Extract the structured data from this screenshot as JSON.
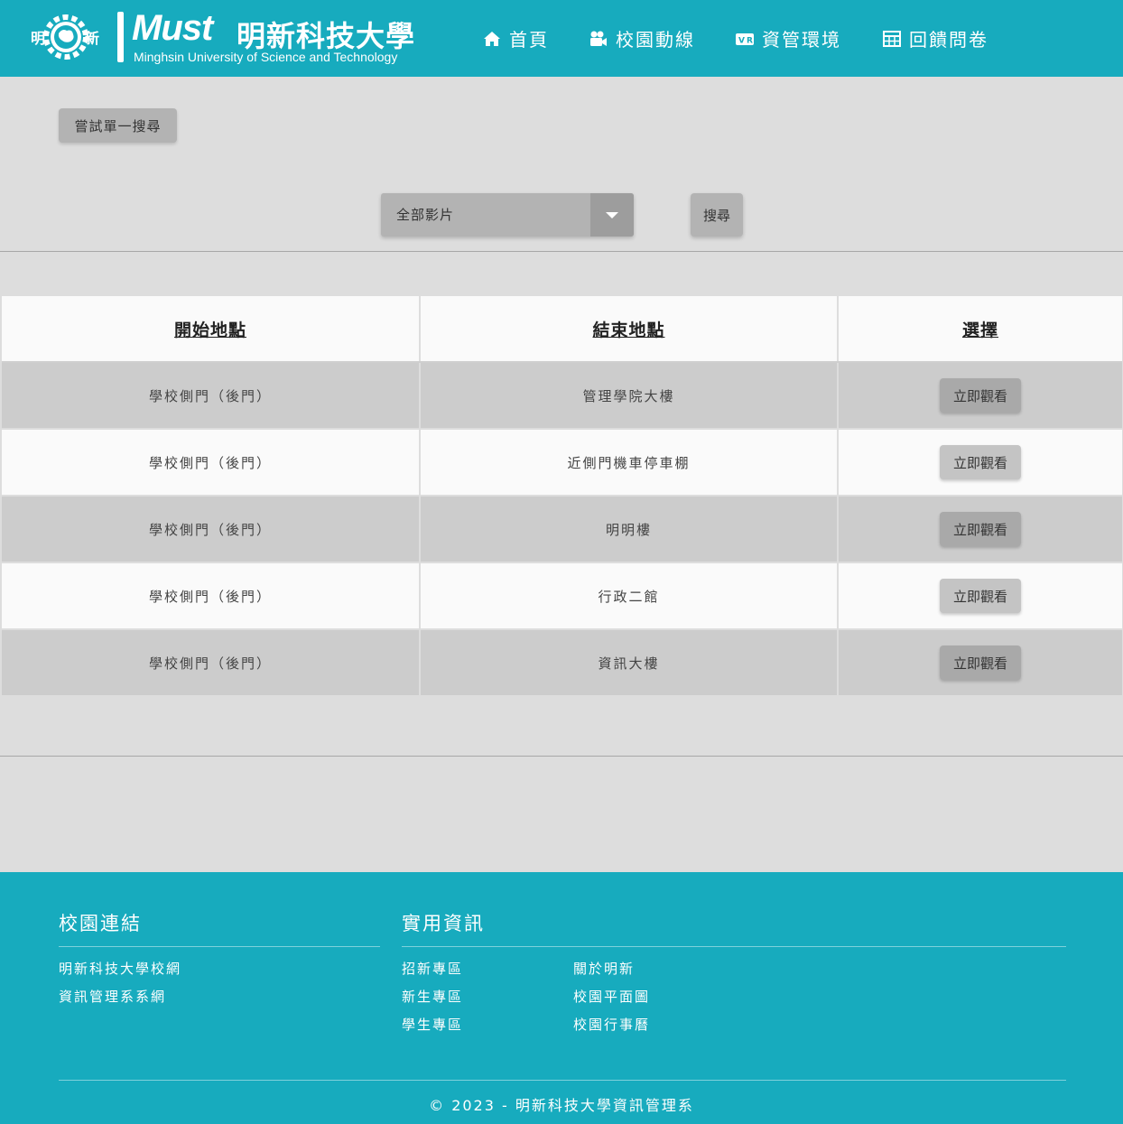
{
  "header": {
    "logo_seal_text": "明新",
    "logo_mark": "Must",
    "logo_name_cn": "明新科技大學",
    "logo_name_en": "Minghsin University of Science and Technology",
    "nav": [
      {
        "label": "首頁",
        "icon": "home-icon"
      },
      {
        "label": "校園動線",
        "icon": "video-camera-icon"
      },
      {
        "label": "資管環境",
        "icon": "vr-icon"
      },
      {
        "label": "回饋問卷",
        "icon": "table-icon"
      }
    ]
  },
  "toolbar": {
    "try_single_search_label": "嘗試單一搜尋",
    "video_select_value": "全部影片",
    "search_label": "搜尋"
  },
  "table": {
    "headers": [
      "開始地點",
      "結束地點",
      "選擇"
    ],
    "rows": [
      {
        "start": "學校側門（後門）",
        "end": "管理學院大樓",
        "action": "立即觀看"
      },
      {
        "start": "學校側門（後門）",
        "end": "近側門機車停車棚",
        "action": "立即觀看"
      },
      {
        "start": "學校側門（後門）",
        "end": "明明樓",
        "action": "立即觀看"
      },
      {
        "start": "學校側門（後門）",
        "end": "行政二館",
        "action": "立即觀看"
      },
      {
        "start": "學校側門（後門）",
        "end": "資訊大樓",
        "action": "立即觀看"
      }
    ]
  },
  "footer": {
    "campus_links_title": "校園連結",
    "campus_links": [
      "明新科技大學校網",
      "資訊管理系系網"
    ],
    "useful_info_title": "實用資訊",
    "useful_info_col1": [
      "招新專區",
      "新生專區",
      "學生專區"
    ],
    "useful_info_col2": [
      "關於明新",
      "校園平面圖",
      "校園行事曆"
    ],
    "copyright": "© 2023 - 明新科技大學資訊管理系"
  },
  "colors": {
    "brand": "#17abbe",
    "page_background": "#dddddd",
    "button_gray": "#b3b3b3"
  }
}
